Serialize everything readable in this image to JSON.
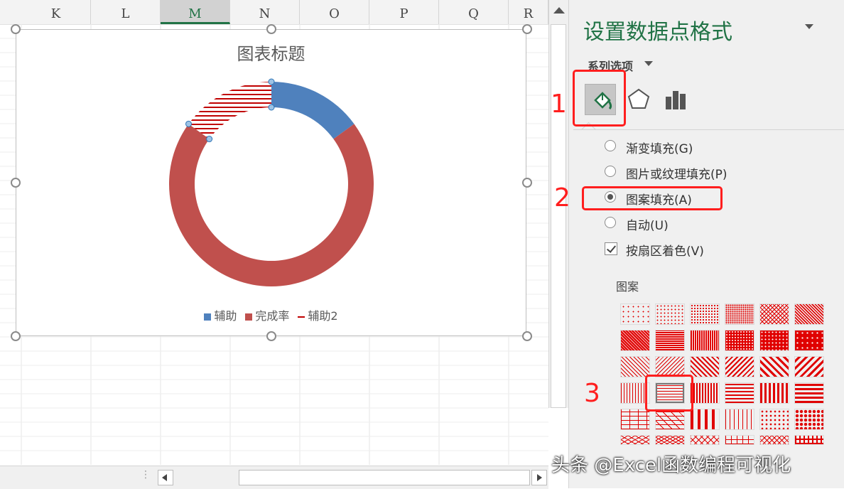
{
  "sheet": {
    "columns": [
      "K",
      "L",
      "M",
      "N",
      "O",
      "P",
      "Q",
      "R"
    ],
    "selected_column": "M"
  },
  "chart": {
    "title": "图表标题",
    "legend": [
      {
        "label": "辅助",
        "color": "#4f81bd",
        "kind": "box"
      },
      {
        "label": "完成率",
        "color": "#c0504d",
        "kind": "box"
      },
      {
        "label": "辅助2",
        "color": "#c00000",
        "kind": "line"
      }
    ],
    "chart_data": {
      "type": "pie",
      "subtype": "doughnut",
      "title": "图表标题",
      "series": [
        {
          "name": "辅助",
          "value_share": 0.15,
          "color": "#4f81bd"
        },
        {
          "name": "完成率",
          "value_share": 0.7,
          "color": "#c0504d"
        },
        {
          "name": "辅助2",
          "value_share": 0.15,
          "color": "#c00000",
          "fill": "horizontal-stripes"
        }
      ],
      "legend_position": "bottom"
    }
  },
  "pane": {
    "title": "设置数据点格式",
    "series_options": "系列选项",
    "options": [
      {
        "label": "渐变填充(G)",
        "type": "radio",
        "checked": false
      },
      {
        "label": "图片或纹理填充(P)",
        "type": "radio",
        "checked": false
      },
      {
        "label": "图案填充(A)",
        "type": "radio",
        "checked": true
      },
      {
        "label": "自动(U)",
        "type": "radio",
        "checked": false
      },
      {
        "label": "按扇区着色(V)",
        "type": "checkbox",
        "checked": true
      }
    ],
    "pattern_label": "图案",
    "pattern_color": "#e00000",
    "selected_pattern": "narrow-horizontal"
  },
  "annotations": {
    "step1": "1",
    "step2": "2",
    "step3": "3"
  },
  "watermark": "头条 @Excel函数编程可视化"
}
